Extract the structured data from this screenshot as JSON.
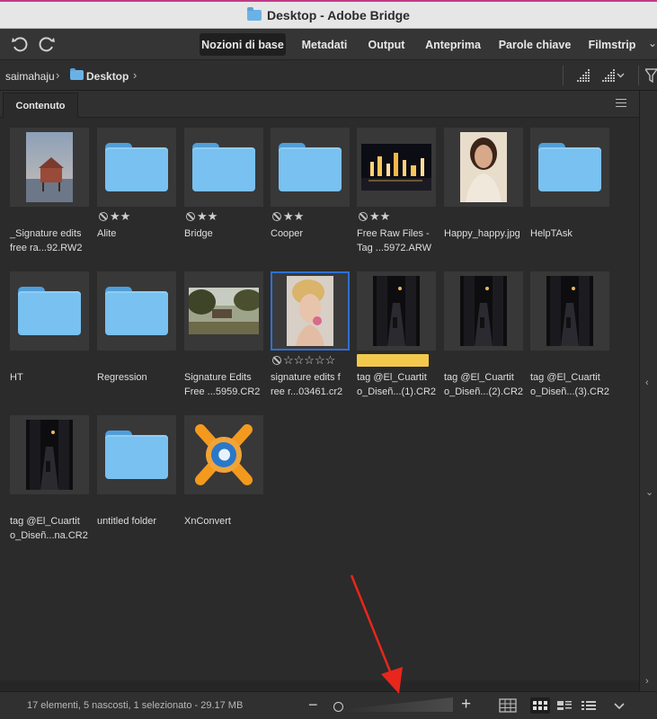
{
  "window": {
    "title": "Desktop - Adobe Bridge"
  },
  "workspaces": [
    {
      "label": "Nozioni di base",
      "active": true
    },
    {
      "label": "Metadati"
    },
    {
      "label": "Output"
    },
    {
      "label": "Anteprima"
    },
    {
      "label": "Parole chiave"
    },
    {
      "label": "Filmstrip"
    }
  ],
  "path": {
    "user": "saimahaju",
    "folder": "Desktop"
  },
  "panel": {
    "tab": "Contenuto"
  },
  "items": [
    {
      "name": "_Signature edits\nfree ra...92.RW2",
      "kind": "image",
      "rating": ""
    },
    {
      "name": "Alite",
      "kind": "folder",
      "rating": "★★"
    },
    {
      "name": "Bridge",
      "kind": "folder",
      "rating": "★★"
    },
    {
      "name": "Cooper",
      "kind": "folder",
      "rating": "★★"
    },
    {
      "name": "Free Raw Files -\nTag ...5972.ARW",
      "kind": "image",
      "rating": "★★"
    },
    {
      "name": "Happy_happy.jpg",
      "kind": "image",
      "rating": ""
    },
    {
      "name": "HelpTAsk",
      "kind": "folder",
      "rating": ""
    },
    {
      "name": "HT",
      "kind": "folder",
      "rating": ""
    },
    {
      "name": "Regression",
      "kind": "folder",
      "rating": ""
    },
    {
      "name": "Signature Edits\nFree ...5959.CR2",
      "kind": "image",
      "rating": ""
    },
    {
      "name": "signature edits f\nree r...03461.cr2",
      "kind": "image",
      "rating": "☆☆☆☆☆",
      "selected": true
    },
    {
      "name": "tag @El_Cuartit\no_Diseñ...(1).CR2",
      "kind": "image",
      "label_color": "#f2c94c"
    },
    {
      "name": "tag @El_Cuartit\no_Diseñ...(2).CR2",
      "kind": "image"
    },
    {
      "name": "tag @El_Cuartit\no_Diseñ...(3).CR2",
      "kind": "image"
    },
    {
      "name": "tag @El_Cuartit\no_Diseñ...na.CR2",
      "kind": "image"
    },
    {
      "name": "untitled folder",
      "kind": "folder"
    },
    {
      "name": "XnConvert",
      "kind": "app"
    }
  ],
  "status": {
    "text": "17 elementi, 5 nascosti, 1 selezionato - 29.17 MB"
  },
  "icons": {
    "rotate_left": "rotate-left-icon",
    "rotate_right": "rotate-right-icon",
    "folder": "folder-icon",
    "reject": "reject-icon"
  },
  "colors": {
    "accent": "#2e70d5",
    "folder": "#79c1f0",
    "label_yellow": "#f2c94c",
    "annotation_arrow": "#e8261c"
  }
}
